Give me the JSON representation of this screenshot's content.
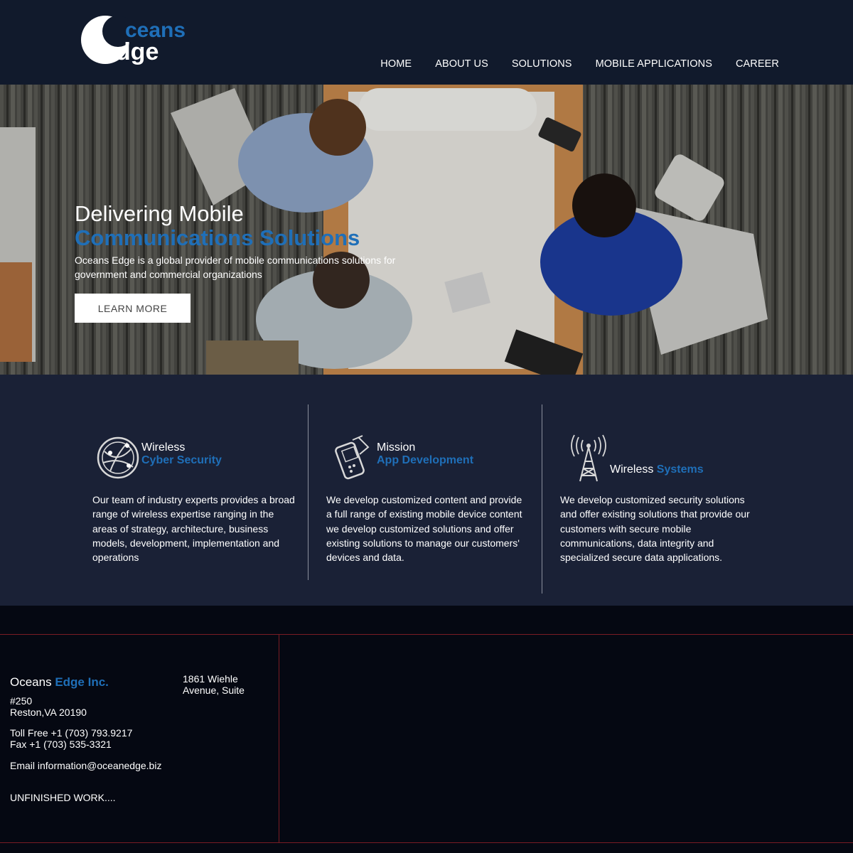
{
  "brand": {
    "logo_top": "ceans",
    "logo_bottom": "edge",
    "accent": "#1f6fb8"
  },
  "nav": [
    {
      "label": "HOME"
    },
    {
      "label": "ABOUT US"
    },
    {
      "label": "SOLUTIONS"
    },
    {
      "label": "MOBILE APPLICATIONS"
    },
    {
      "label": "CAREER"
    }
  ],
  "hero": {
    "line1": "Delivering Mobile",
    "line2": "Communications Solutions",
    "description": "Oceans Edge is a global provider of mobile communications solutions for government and commercial organizations",
    "button": "LEARN MORE"
  },
  "features": [
    {
      "icon": "globe-icon",
      "title1": "Wireless",
      "title2": "Cyber Security",
      "text": "Our team of industry experts provides a broad range of wireless expertise ranging in the areas of strategy, architecture, business models, development, implementation and operations"
    },
    {
      "icon": "mobile-device-icon",
      "title1": "Mission",
      "title2": "App Development",
      "text": "We develop customized content and provide a full range of existing mobile device content we develop customized solutions and offer existing solutions to manage our customers' devices and data."
    },
    {
      "icon": "antenna-tower-icon",
      "title1": "Wireless",
      "title2": "Systems",
      "text": "We develop customized security solutions and offer existing solutions that provide our customers with secure mobile communications, data integrity and specialized secure data applications."
    }
  ],
  "footer": {
    "company1": "Oceans",
    "company2": "Edge Inc.",
    "address_right": "1861 Wiehle Avenue, Suite",
    "address_line1": "#250",
    "address_line2": "Reston,VA 20190",
    "tollfree": "Toll Free +1 (703) 793.9217",
    "fax": "Fax +1 (703) 535-3321",
    "email": "Email information@oceanedge.biz",
    "note": "UNFINISHED WORK...."
  }
}
